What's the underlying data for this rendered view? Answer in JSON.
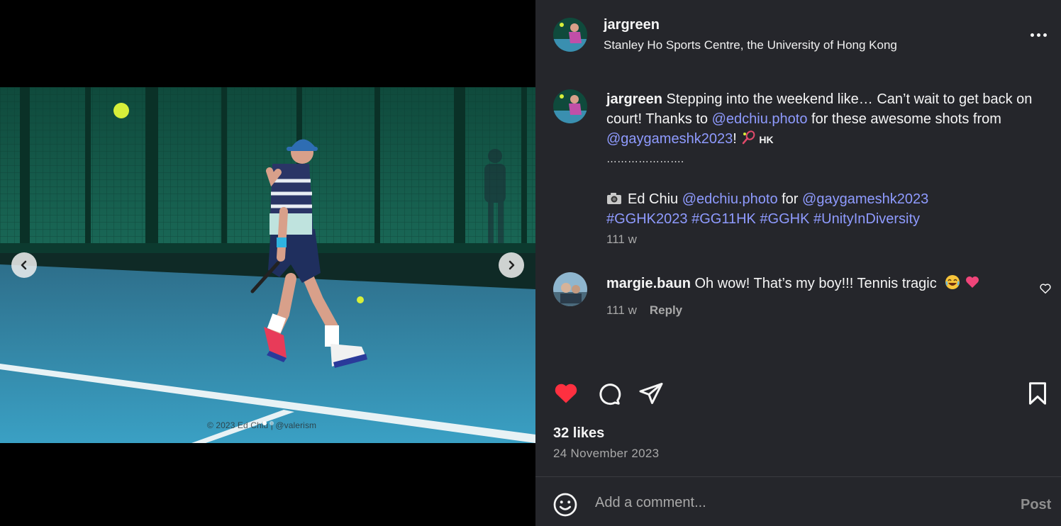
{
  "post": {
    "username": "jargreen",
    "location": "Stanley Ho Sports Centre, the University of Hong Kong",
    "caption": {
      "text_1": "Stepping into the weekend like… Can’t wait to get back on court! Thanks to",
      "mention_photographer": "@edchiu.photo",
      "text_2": "for these awesome shots from",
      "mention_event": "@gaygameshk2023",
      "text_3": "!",
      "flag_text": "HK",
      "separator": "………………….",
      "credit_name": "Ed Chiu",
      "credit_mention": "@edchiu.photo",
      "credit_for": "for",
      "credit_event": "@gaygameshk2023",
      "hashtags": [
        "#GGHK2023",
        "#GG11HK",
        "#GGHK",
        "#UnityInDiversity"
      ]
    },
    "time_ago": "111 w",
    "likes": "32 likes",
    "date": "24 November 2023",
    "liked": true
  },
  "media": {
    "watermark": "© 2023 Ed Chiu  |  @valerism",
    "slide_count": 2,
    "active_slide": 1
  },
  "comments": [
    {
      "username": "margie.baun",
      "text": "Oh wow! That’s my boy!!! Tennis tragic",
      "time_ago": "111 w",
      "reply_label": "Reply"
    }
  ],
  "composer": {
    "placeholder": "Add a comment...",
    "post_label": "Post"
  },
  "icons": {
    "more": "more-horizontal-icon",
    "like": "heart-filled-icon",
    "comment": "comment-bubble-icon",
    "share": "send-icon",
    "save": "bookmark-icon",
    "emoji": "smiley-icon",
    "prev": "chevron-left-icon",
    "next": "chevron-right-icon"
  },
  "colors": {
    "panel_bg": "#25262b",
    "link": "#8f9bff",
    "like_red": "#ff3040",
    "muted": "#a8a8a8"
  }
}
